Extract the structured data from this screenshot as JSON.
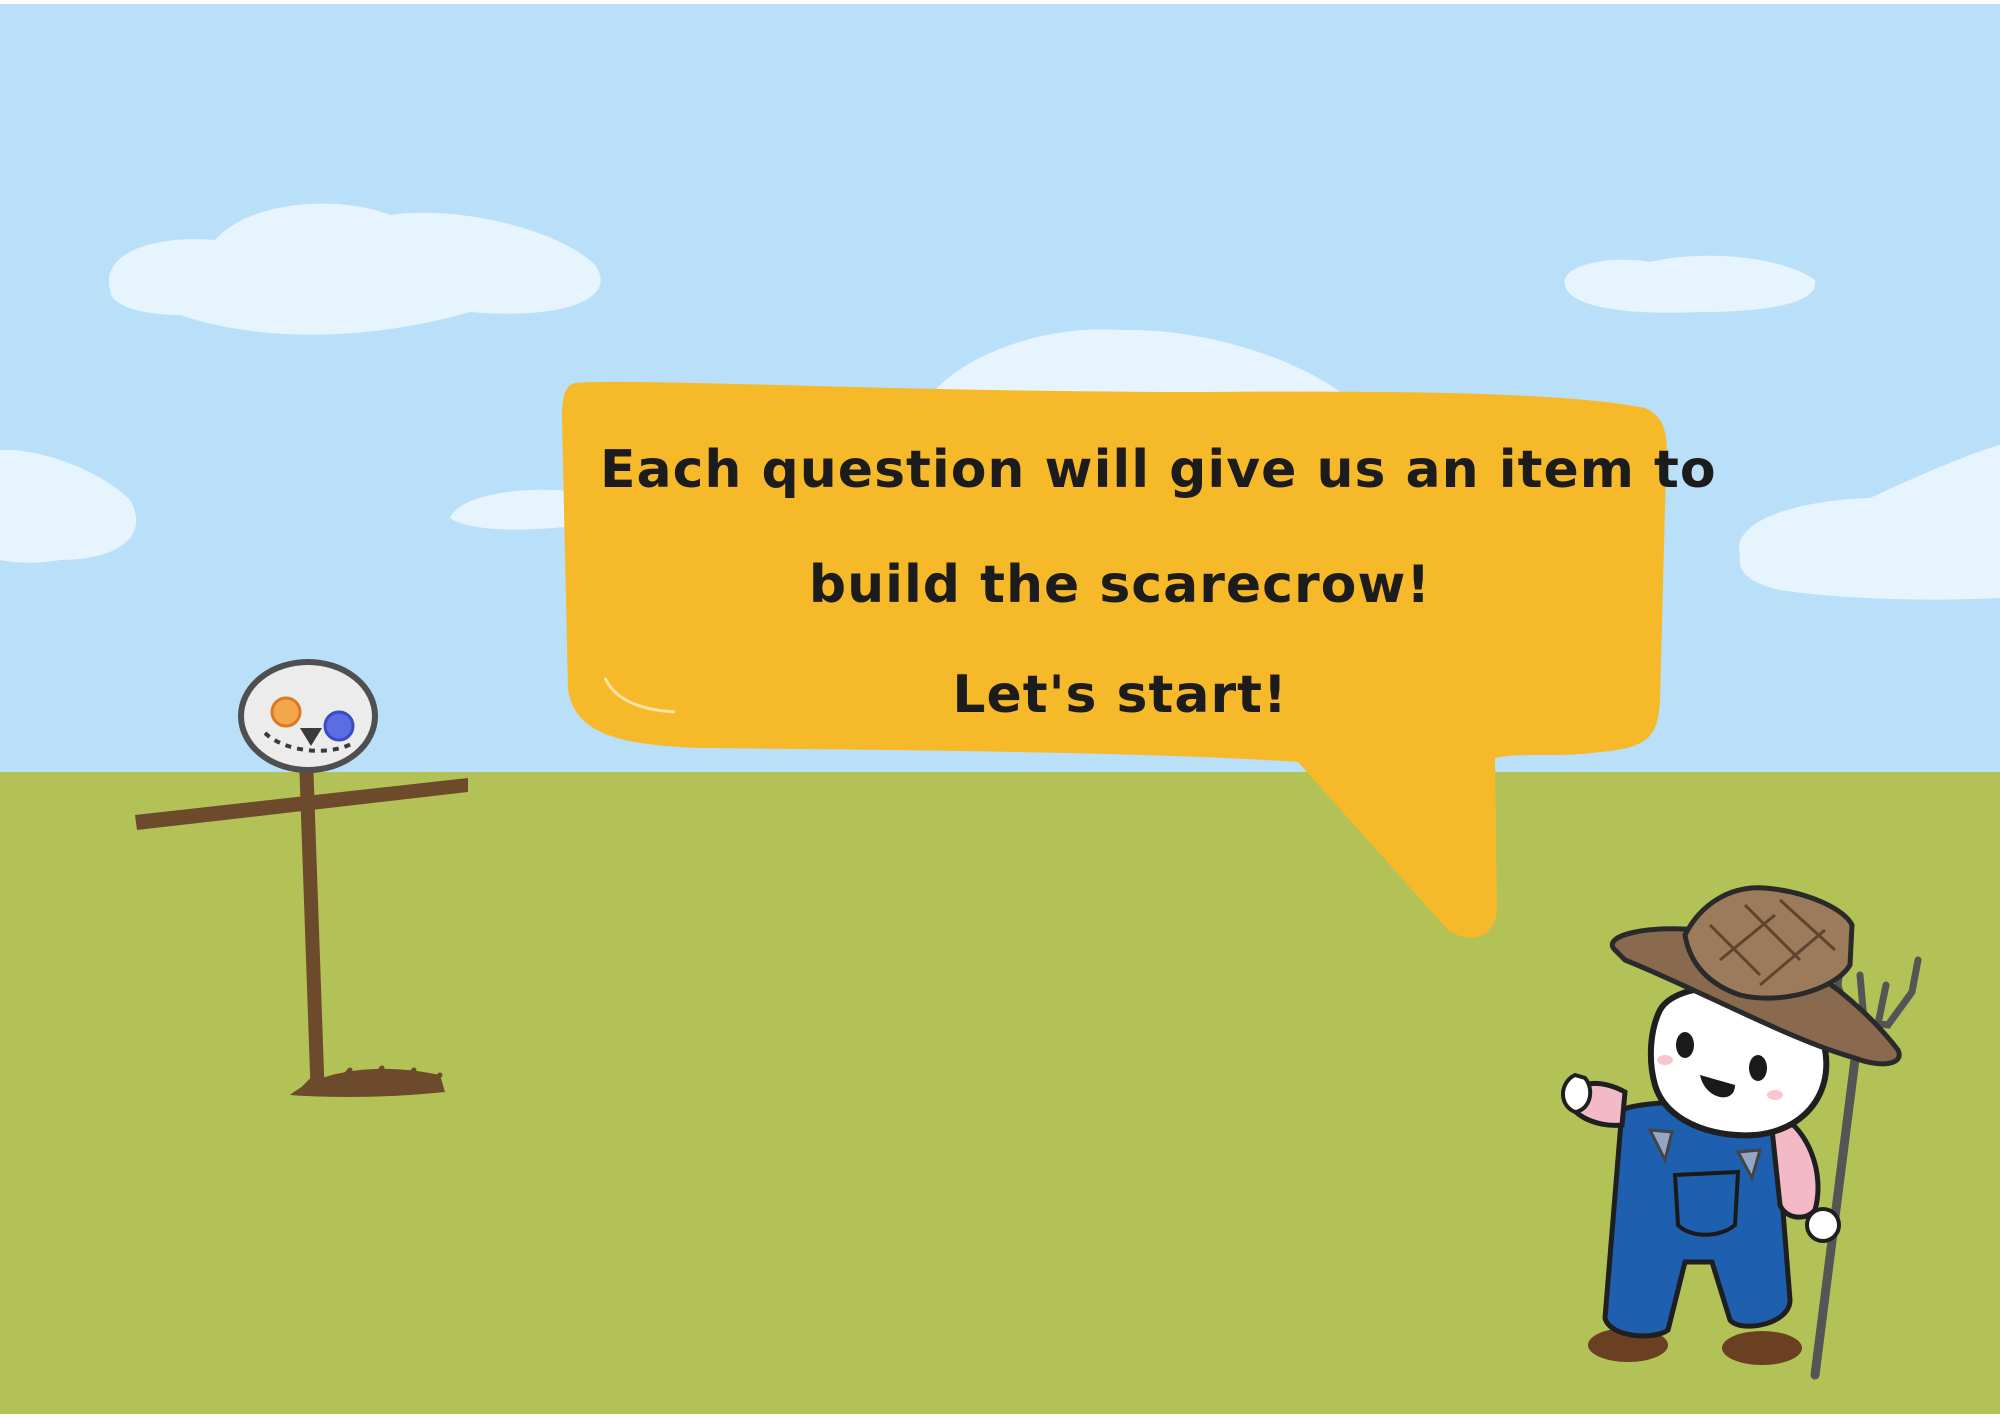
{
  "dialogue": {
    "line1": "Each question will give us an item to",
    "line2": "build the scarecrow!",
    "line3": "Let's start!"
  },
  "colors": {
    "sky": "#b9e0f8",
    "cloud": "#e6f4fd",
    "grass": "#b3c256",
    "bubble": "#f6b929",
    "wood": "#6e4a2c",
    "overalls": "#1f5fb0",
    "hat": "#8a6a4e"
  },
  "icons": {
    "scarecrow": "scarecrow-icon",
    "farmer": "farmer-icon",
    "pitchfork": "pitchfork-icon"
  }
}
